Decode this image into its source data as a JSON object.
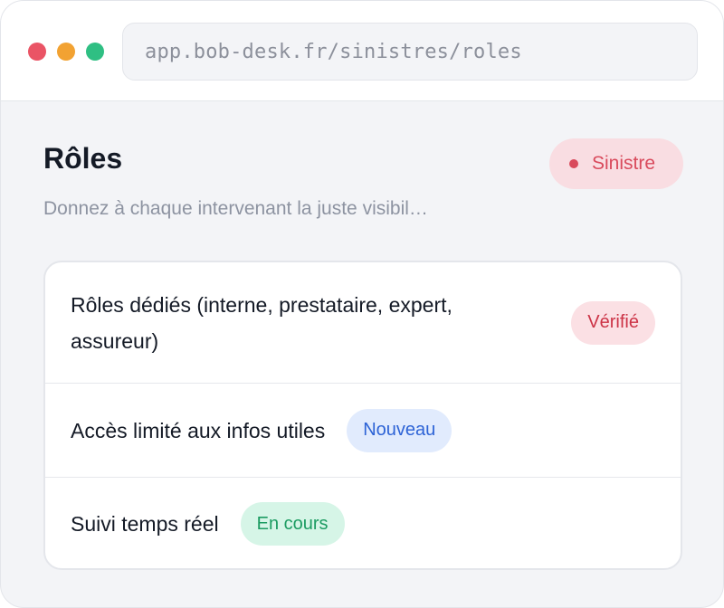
{
  "colors": {
    "dot_red": "#ea5465",
    "dot_yellow": "#f2a232",
    "dot_green": "#2fbf83",
    "sinistre_bg": "#f9dde2",
    "sinistre_text": "#d94a5c",
    "verifie_bg": "#fbe0e4",
    "verifie_text": "#cc3346",
    "nouveau_bg": "#e1ebfd",
    "nouveau_text": "#2d63d6",
    "encours_bg": "#d6f5e7",
    "encours_text": "#1c9c62"
  },
  "browser": {
    "url": "app.bob-desk.fr/sinistres/roles"
  },
  "header": {
    "title": "Rôles",
    "badge_label": "Sinistre",
    "subtitle": "Donnez à chaque intervenant la juste visibil…"
  },
  "items": [
    {
      "label": "Rôles dédiés (interne, prestataire, expert, assureur)",
      "tag": "Vérifié"
    },
    {
      "label": "Accès limité aux infos utiles",
      "tag": "Nouveau"
    },
    {
      "label": "Suivi temps réel",
      "tag": "En cours"
    }
  ]
}
